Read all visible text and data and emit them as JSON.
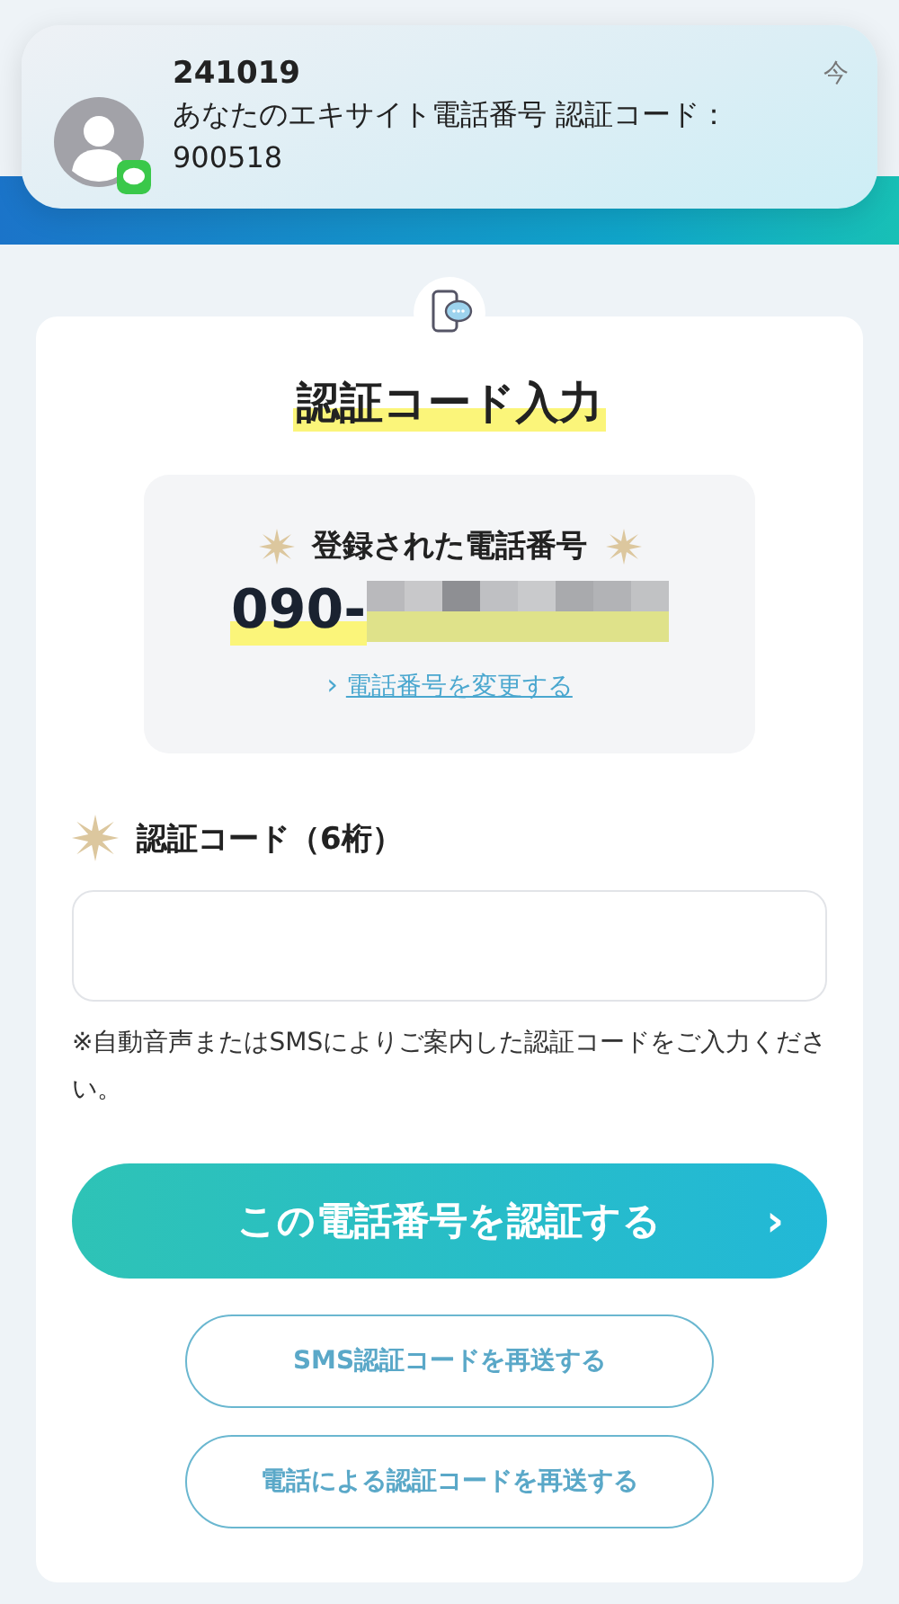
{
  "notification": {
    "sender": "241019",
    "message": "あなたのエキサイト電話番号 認証コード：900518",
    "time": "今"
  },
  "title": "認証コード入力",
  "registered_phone": {
    "label": "登録された電話番号",
    "number": "090-",
    "change_link": "電話番号を変更する",
    "link_arrow": "›"
  },
  "code_field": {
    "label": "認証コード（6桁）",
    "note": "※自動音声またはSMSによりご案内した認証コードをご入力ください。"
  },
  "buttons": [
    {
      "label": "この電話番号を認証する",
      "kind": "primary",
      "arrow": "›"
    },
    {
      "label": "SMS認証コードを再送する",
      "kind": "secondary"
    },
    {
      "label": "電話による認証コードを再送する",
      "kind": "secondary"
    }
  ]
}
